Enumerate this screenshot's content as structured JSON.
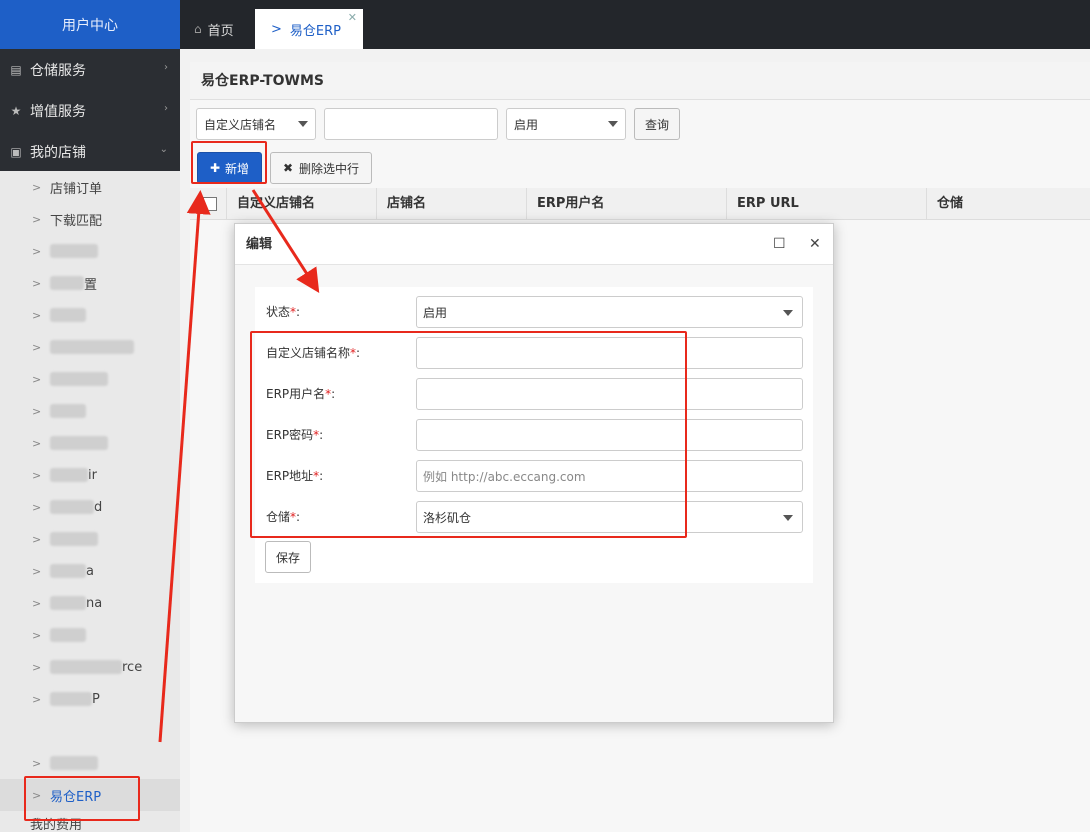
{
  "sidebar": {
    "header": "用户中心",
    "menus": [
      {
        "label": "仓储服务",
        "icon": "bank-icon"
      },
      {
        "label": "增值服务",
        "icon": "star-icon"
      },
      {
        "label": "我的店铺",
        "icon": "shopping-bag-icon"
      }
    ],
    "items": [
      {
        "label": "店铺订单"
      },
      {
        "label": "下载匹配"
      },
      {
        "label": "",
        "suffix": ""
      },
      {
        "label": "",
        "suffix": "置"
      },
      {
        "label": "",
        "suffix": ""
      },
      {
        "label": "",
        "suffix": ""
      },
      {
        "label": "",
        "suffix": ""
      },
      {
        "label": "",
        "suffix": ""
      },
      {
        "label": "",
        "suffix": ""
      },
      {
        "label": "",
        "suffix": "ir"
      },
      {
        "label": "",
        "suffix": "d"
      },
      {
        "label": "",
        "suffix": ""
      },
      {
        "label": "",
        "suffix": "a"
      },
      {
        "label": "",
        "suffix": "na"
      },
      {
        "label": "",
        "suffix": ""
      },
      {
        "label": "",
        "suffix": "rce"
      },
      {
        "label": "",
        "suffix": "P"
      },
      {
        "label": "",
        "suffix": ""
      },
      {
        "label": "易仓ERP"
      }
    ],
    "bottom_label": "我的费用"
  },
  "tabs": {
    "home": "首页",
    "active": "易仓ERP"
  },
  "panel": {
    "title": "易仓ERP-TOWMS",
    "filter_select": "自定义店铺名",
    "filter_input": "",
    "status_select": "启用",
    "query_button": "查询",
    "add_button": "新增",
    "delete_button": "删除选中行"
  },
  "table": {
    "headers": [
      "自定义店铺名",
      "店铺名",
      "ERP用户名",
      "ERP URL",
      "仓储"
    ]
  },
  "modal": {
    "title": "编辑",
    "fields": [
      {
        "label": "状态",
        "value": "启用",
        "type": "select"
      },
      {
        "label": "自定义店铺名称",
        "value": "",
        "type": "input"
      },
      {
        "label": "ERP用户名",
        "value": "",
        "type": "input"
      },
      {
        "label": "ERP密码",
        "value": "",
        "type": "input"
      },
      {
        "label": "ERP地址",
        "value": "",
        "placeholder": "例如 http://abc.eccang.com",
        "type": "input"
      },
      {
        "label": "仓储",
        "value": "洛杉矶仓",
        "type": "select"
      }
    ],
    "required_mark": "*",
    "colon": ":",
    "save_button": "保存"
  },
  "colors": {
    "accent": "#1e5fc7",
    "annotation": "#e8291c"
  }
}
